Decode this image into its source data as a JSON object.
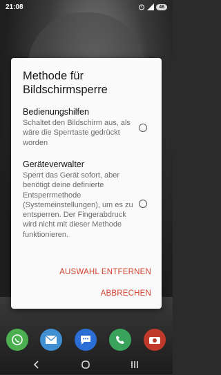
{
  "status_bar": {
    "time": "21:08",
    "battery_level": "46",
    "icons": [
      "alarm-icon",
      "signal-icon",
      "battery-icon"
    ]
  },
  "dialog": {
    "title": "Methode für Bildschirmsperre",
    "options": [
      {
        "title": "Bedienungshilfen",
        "description": "Schaltet den Bildschirm aus, als wäre die Sperrtaste gedrückt worden",
        "selected": false
      },
      {
        "title": "Geräteverwalter",
        "description": "Sperrt das Gerät sofort, aber benötigt deine definierte Entsperrmethode (Systemeinstellungen), um es zu entsperren. Der Fingerabdruck wird nicht mit dieser Methode funktionieren.",
        "selected": false
      }
    ],
    "remove_selection_label": "AUSWAHL ENTFERNEN",
    "cancel_label": "ABBRECHEN",
    "accent_color": "#d2402f"
  },
  "dock": {
    "apps": [
      {
        "icon": "whatsapp-icon",
        "color": "#4caf50"
      },
      {
        "icon": "mail-icon",
        "color": "#3f8fd2"
      },
      {
        "icon": "messages-icon",
        "color": "#2b6fd6"
      },
      {
        "icon": "phone-icon",
        "color": "#3aa35b"
      },
      {
        "icon": "camera-icon",
        "color": "#c0392b"
      }
    ]
  },
  "navigation": {
    "icons": [
      "back-icon",
      "home-icon",
      "recents-icon"
    ]
  }
}
